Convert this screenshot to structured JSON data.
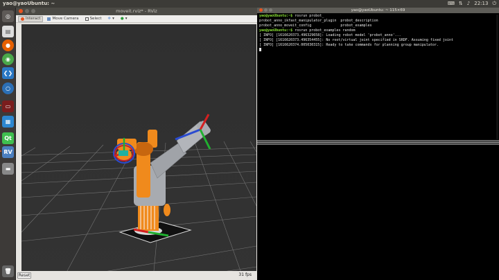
{
  "topbar": {
    "title": "yao@yaoUbuntu: ~",
    "time": "22:13"
  },
  "rviz": {
    "window_title": "moveit.rviz* - RViz",
    "toolbar": {
      "interact": "Interact",
      "move_camera": "Move Camera",
      "select": "Select"
    },
    "reset_label": "Reset",
    "fps": "31 fps"
  },
  "terminal": {
    "window_title": "yao@yaoUbuntu: ~ 115×69",
    "lines": [
      {
        "prompt": "yao@yaoUbuntu:~$ ",
        "text": "rosrun probot_"
      },
      {
        "text": "probot_anno_ikfast_manipulator_plugin  probot_description"
      },
      {
        "text": "probot_anno_moveit_config              probot_examples"
      },
      {
        "prompt": "yao@yaoUbuntu:~$ ",
        "text": "rosrun probot_examples random"
      },
      {
        "text": "[ INFO] [1616620373.496329658]: Loading robot model 'probot_anno'..."
      },
      {
        "text": "[ INFO] [1616620373.496354455]: No root/virtual joint specified in SRDF. Assuming fixed joint"
      },
      {
        "text": "[ INFO] [1616620374.005030315]: Ready to take commands for planning group manipulator."
      }
    ]
  },
  "colors": {
    "ubuntu_orange": "#e95420",
    "robot_orange": "#f08a1c",
    "robot_grey": "#a8abb0",
    "terminal_green": "#8ae234",
    "terminal_blue": "#729fcf"
  }
}
